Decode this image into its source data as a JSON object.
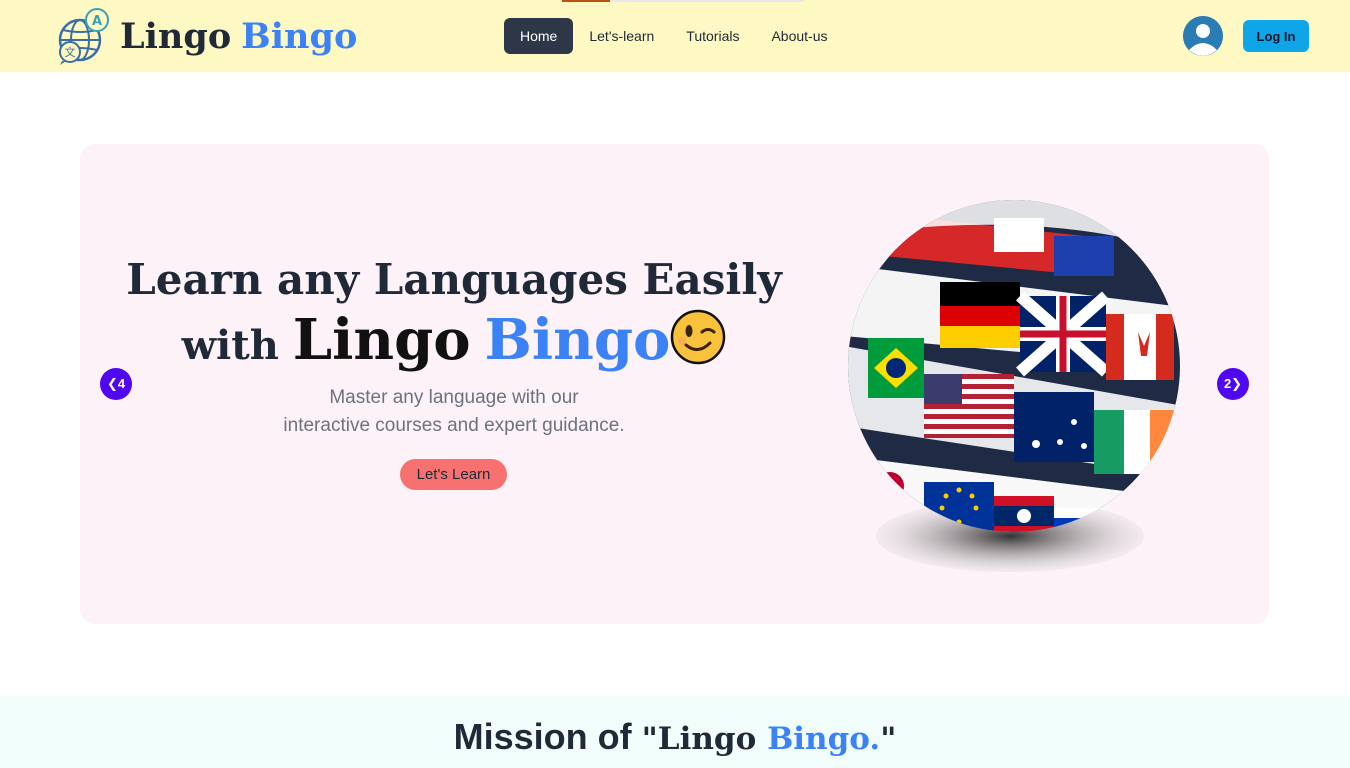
{
  "header": {
    "brand_part1": "Lingo",
    "brand_part2": "Bingo",
    "nav": [
      {
        "label": "Home",
        "active": true
      },
      {
        "label": "Let's-learn",
        "active": false
      },
      {
        "label": "Tutorials",
        "active": false
      },
      {
        "label": "About-us",
        "active": false
      }
    ],
    "login_label": "Log In",
    "logo_icon": "language-globe-icon",
    "avatar_icon": "user-avatar-icon"
  },
  "hero": {
    "title_line1": "Learn any Languages Easily",
    "title_with": "with",
    "title_brand1": "Lingo",
    "title_brand2": "Bingo",
    "emoji": "winking-face-icon",
    "subtitle_line1": "Master any language with our",
    "subtitle_line2": "interactive courses and expert guidance.",
    "cta_label": "Let's Learn",
    "prev_label": "❮4",
    "next_label": "2❯",
    "image": "flag-globe-image"
  },
  "mission": {
    "prefix": "Mission of",
    "quote_open": "\"Lingo",
    "brand_blue": "Bingo.",
    "quote_close": "\""
  },
  "colors": {
    "header_bg": "#fef9c3",
    "brand_blue": "#3b82f6",
    "hero_bg": "#fdf2f8",
    "cta_bg": "#f87171",
    "arrow_bg": "#4f08f0",
    "login_bg": "#0ea5e9",
    "mission_bg": "#f0fdfa"
  }
}
